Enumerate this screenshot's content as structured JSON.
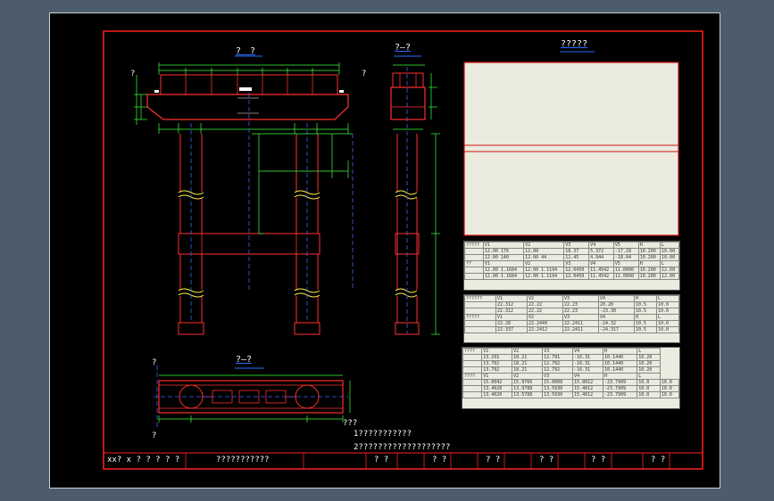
{
  "colors": {
    "background": "#4d5c6c",
    "model_space": "#000000",
    "frame": "#ff2020",
    "structure": "#ff3030",
    "dimension": "#3cff3c",
    "centerline": "#4060ff",
    "text": "#ffffff",
    "table_fill": "#ecebe0",
    "break_line": "#ffee44"
  },
  "views": {
    "front_title": "?　?",
    "side_title": "?—?",
    "plan_title": "?—?",
    "notes_title": "?????"
  },
  "notes": {
    "line1": "1???????????",
    "line2": "2???????????????????"
  },
  "annotations": {
    "side_label_left": "?",
    "side_label_right": "?",
    "mark": "?",
    "plan_left_mark": "?",
    "plan_footer": "???"
  },
  "title_block": {
    "cell1": "xx? x ? ? ? ? ?",
    "cell2": "???????????",
    "cell3": "? ?",
    "cell4": "? ?",
    "cell5": "? ?",
    "cell6": "? ?",
    "cell7": "? ?",
    "cell8": "? ?"
  },
  "tables": {
    "t1_rows": [
      [
        "?????",
        "V1",
        "V2",
        "V3",
        "V4",
        "V5",
        "H",
        "L"
      ],
      [
        "",
        "12.00 176",
        "12.00",
        "18.37",
        "5.372",
        "-17.28",
        "10.200",
        "10.00"
      ],
      [
        "",
        "12.00 140",
        "12.00 44",
        "12.45",
        "4.944",
        "-18.04",
        "10.200",
        "10.00"
      ],
      [
        "??",
        "V1",
        "V2",
        "V3",
        "V4",
        "V5",
        "H",
        "L"
      ],
      [
        "",
        "12.00 1.1684",
        "12.00 1.1194",
        "12.0450",
        "11.4542",
        "11.0000",
        "10.200",
        "12.00"
      ],
      [
        "",
        "12.00 1.1684",
        "12.00 1.1194",
        "12.0450",
        "11.4542",
        "11.0000",
        "10.200",
        "12.00"
      ]
    ],
    "t2_rows": [
      [
        "??????",
        "V1",
        "V2",
        "V3",
        "V4",
        "H",
        "L"
      ],
      [
        "",
        "22.312",
        "22.22",
        "22.23",
        "20.20",
        "10.5",
        "10.0"
      ],
      [
        "",
        "22.312",
        "22.22",
        "22.23",
        "-23.30",
        "10.5",
        "10.0"
      ],
      [
        "?????",
        "V1",
        "V2",
        "V3",
        "V4",
        "H",
        "L"
      ],
      [
        "",
        "22.28",
        "22.2449",
        "22.2411",
        "-24.32",
        "10.5",
        "10.0"
      ],
      [
        "",
        "22.337",
        "22.2412",
        "22.2411",
        "-24.317",
        "10.5",
        "10.0"
      ]
    ],
    "t3_rows": [
      [
        "????",
        "V1",
        "V2",
        "V3",
        "V4",
        "H",
        "L"
      ],
      [
        "",
        "13.291",
        "18.21",
        "12.791",
        "-16.31",
        "10.1440",
        "10.20"
      ],
      [
        "",
        "13.792",
        "18.21",
        "12.792",
        "-16.31",
        "10.1440",
        "10.20"
      ],
      [
        "",
        "13.792",
        "18.21",
        "12.792",
        "-16.31",
        "10.1440",
        "10.20"
      ],
      [
        "????",
        "V1",
        "V2",
        "V3",
        "V4",
        "H",
        "L"
      ],
      [
        "",
        "15.0042",
        "15.9766",
        "15.0008",
        "15.8012",
        "-23.7909",
        "10.0",
        "10.0"
      ],
      [
        "",
        "13.4020",
        "13.9788",
        "13.5930",
        "15.4012",
        "-23.7909",
        "10.0",
        "10.0"
      ],
      [
        "",
        "13.4020",
        "13.5788",
        "13.5930",
        "15.4012",
        "-23.7909",
        "10.0",
        "10.0"
      ]
    ]
  }
}
